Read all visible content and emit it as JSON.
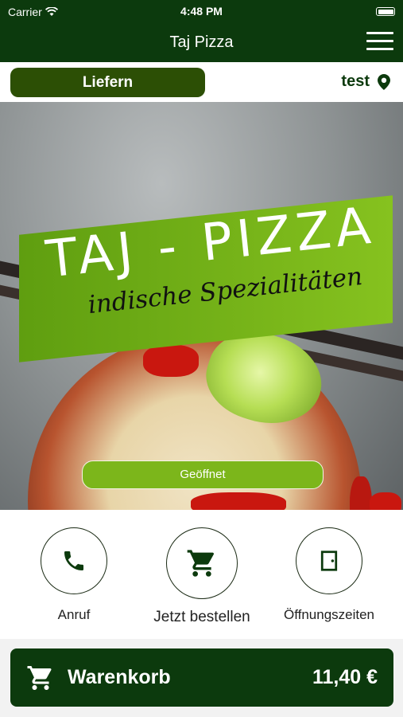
{
  "status_bar": {
    "carrier": "Carrier",
    "time": "4:48 PM"
  },
  "navbar": {
    "title": "Taj Pizza"
  },
  "delivery": {
    "mode_label": "Liefern",
    "location_label": "test"
  },
  "hero": {
    "title": "TAJ - PIZZA",
    "subtitle": "indische Spezialitäten",
    "status": "Geöffnet"
  },
  "actions": {
    "call_label": "Anruf",
    "order_label": "Jetzt bestellen",
    "hours_label": "Öffnungszeiten"
  },
  "cart": {
    "label": "Warenkorb",
    "total": "11,40 €"
  },
  "colors": {
    "primary": "#0c3a0d",
    "deliver_button": "#2c4f05",
    "accent": "#7cb61b"
  }
}
